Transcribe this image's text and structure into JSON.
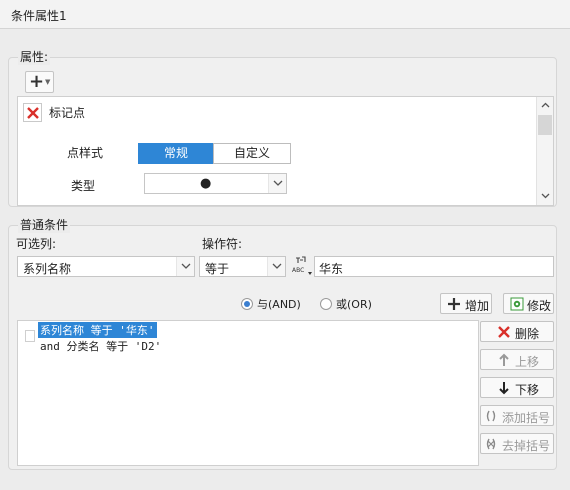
{
  "window": {
    "title": "条件属性1"
  },
  "attributes": {
    "group_label": "属性:",
    "add_icon": "plus-icon",
    "marker": {
      "delete_icon": "red-x-icon",
      "title": "标记点",
      "style_label": "点样式",
      "style_options": [
        "常规",
        "自定义"
      ],
      "style_selected": "常规",
      "type_label": "类型",
      "type_value": "●"
    }
  },
  "conditions": {
    "group_label": "普通条件",
    "selectable_label": "可选列:",
    "selectable_value": "系列名称",
    "operator_label": "操作符:",
    "operator_value": "等于",
    "formula_icon": "abc-formula-icon",
    "value_input": "华东",
    "and_label": "与(AND)",
    "or_label": "或(OR)",
    "logic_selected": "and",
    "add_button": "增加",
    "modify_button": "修改",
    "list": [
      "系列名称 等于 '华东'",
      "and 分类名 等于 'D2'"
    ],
    "buttons": {
      "delete": "删除",
      "move_up": "上移",
      "move_down": "下移",
      "add_bracket": "添加括号",
      "remove_bracket": "去掉括号"
    }
  },
  "colors": {
    "accent": "#2e86d6",
    "danger": "#d9302a",
    "success": "#3a9a3a"
  }
}
